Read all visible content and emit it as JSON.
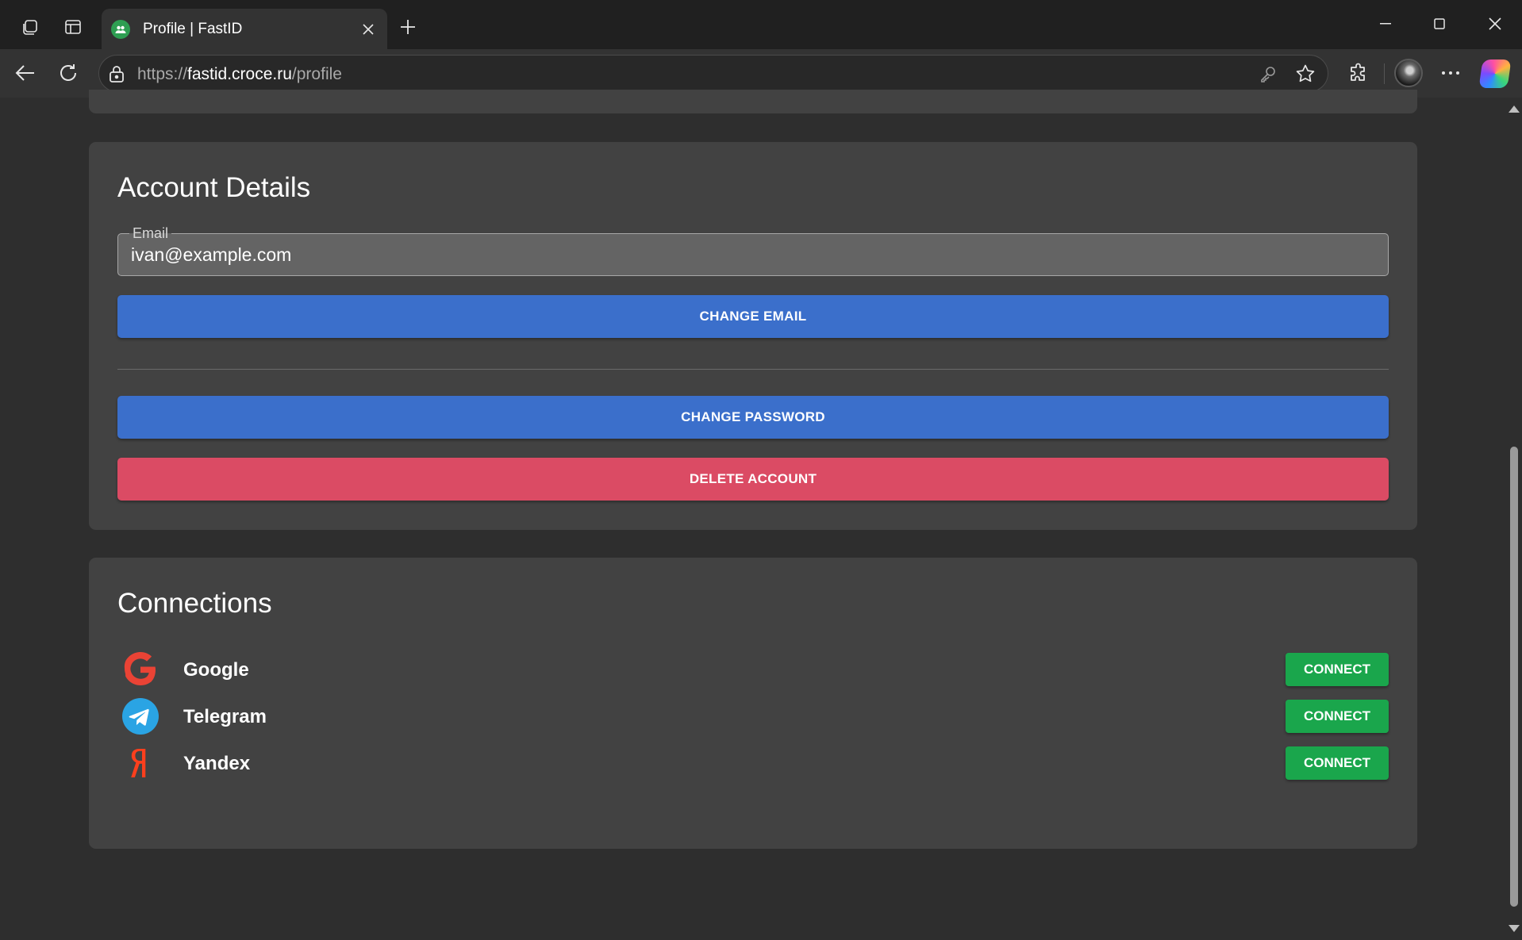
{
  "browser": {
    "tab": {
      "title": "Profile | FastID",
      "favicon": "users-icon"
    },
    "address": {
      "scheme": "https://",
      "host": "fastid.croce.ru",
      "path": "/profile"
    }
  },
  "account": {
    "heading": "Account Details",
    "email": {
      "label": "Email",
      "value": "ivan@example.com"
    },
    "change_email_label": "CHANGE EMAIL",
    "change_password_label": "CHANGE PASSWORD",
    "delete_account_label": "DELETE ACCOUNT"
  },
  "connections": {
    "heading": "Connections",
    "items": [
      {
        "name": "Google",
        "icon": "google-icon",
        "color": "#ea4335",
        "action": "CONNECT"
      },
      {
        "name": "Telegram",
        "icon": "telegram-icon",
        "color": "#2aa4e4",
        "action": "CONNECT"
      },
      {
        "name": "Yandex",
        "icon": "yandex-icon",
        "color": "#fc3f1d",
        "action": "CONNECT"
      }
    ]
  },
  "colors": {
    "primary": "#3b6fcb",
    "danger": "#db4b64",
    "success": "#1aa64c"
  }
}
